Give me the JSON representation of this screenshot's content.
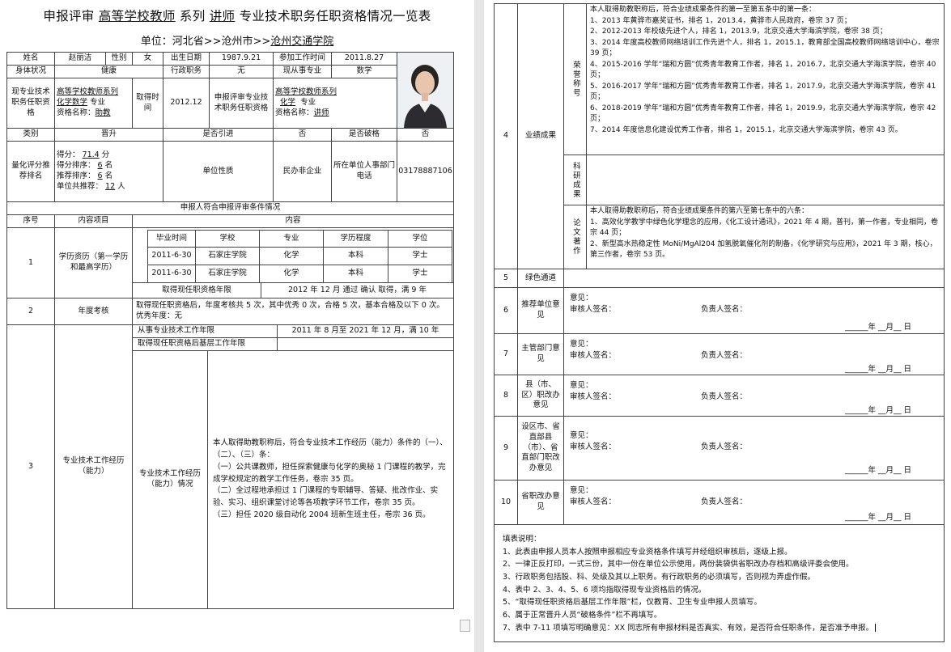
{
  "header": {
    "title_prefix": "申报评审",
    "series": "高等学校教师",
    "series_suffix": "系列",
    "level": "讲师",
    "title_suffix": "专业技术职务任职资格情况一览表",
    "unit_label": "单位：河北省>>沧州市>>",
    "unit_name": "沧州交通学院"
  },
  "basic": {
    "name_label": "姓名",
    "name": "赵丽洁",
    "gender_label": "性别",
    "gender": "女",
    "dob_label": "出生日期",
    "dob": "1987.9.21",
    "work_start_label": "参加工作时间",
    "work_start": "2011.8.27",
    "health_label": "身体状况",
    "health": "健康",
    "admin_label": "行政职务",
    "admin": "无",
    "major_label": "现从事专业",
    "major": "数学",
    "cur_title_label": "现专业技术职务任职资格",
    "cur_series": "高等学校教师系列",
    "cur_major": "化学数学",
    "cur_major_suffix": "专业",
    "cur_qual_label": "资格名称：",
    "cur_qual": "助教",
    "obtain_label": "取得时间",
    "obtain": "2012.12",
    "apply_label": "申报评审专业技术职务任职资格",
    "apply_series": "高等学校教师系列",
    "apply_major": "化学",
    "apply_major_suffix": "专业",
    "apply_qual_label": "资格名称：",
    "apply_qual": "讲师",
    "type_label": "类别",
    "type": "晋升",
    "intro_label": "是否引进",
    "intro": "否",
    "exception_label": "是否破格",
    "exception": "否",
    "score_label": "量化评分推荐排名",
    "score_l1": "得分：",
    "score": "71.4",
    "score_u": "分",
    "rank_l": "得分排序：",
    "rank": "6",
    "rank_u": "名",
    "rec_l": "推荐排序：",
    "rec": "6",
    "rec_u": "名",
    "total_l": "单位共推荐：",
    "total": "12",
    "total_u": "人",
    "nature_label": "单位性质",
    "nature": "民办非企业",
    "hr_label": "所在单位人事部门电话",
    "hr_phone": "03178887106"
  },
  "conditions": {
    "heading": "申报人符合申报评审条件情况",
    "col_no": "序号",
    "col_item": "内容项目",
    "col_content": "内容",
    "r1_no": "1",
    "r1_item": "学历资历（第一学历和最高学历）",
    "edu_headers": [
      "毕业时间",
      "学校",
      "专业",
      "学历程度",
      "学位"
    ],
    "edu_rows": [
      [
        "2011-6-30",
        "石家庄学院",
        "化学",
        "本科",
        "学士"
      ],
      [
        "2011-6-30",
        "石家庄学院",
        "化学",
        "本科",
        "学士"
      ]
    ],
    "qual_years_label": "取得现任职资格年限",
    "qual_years": "2012 年 12 月  通过  确认 取得，满 9 年",
    "r2_no": "2",
    "r2_item": "年度考核",
    "r2_text": "取得现任职资格后，年度考核共 5 次，其中优秀 0 次，合格 5 次，基本合格及以下 0 次。优秀年度：无",
    "r3_no": "3",
    "r3_item": "专业技术工作经历（能力）",
    "r3_years_label": "从事专业技术工作年限",
    "r3_years": "2011 年 8 月至 2021 年 12 月，满 10 年",
    "r3_grass_label": "取得现任职资格后基层工作年限",
    "r3_sub": "专业技术工作经历（能力）情况",
    "r3_text": "本人取得助教职称后，符合专业技术工作经历（能力）条件的（一）、（二）、（三）条：\n（一）公共课教师，担任探索健康与化学的奥秘 1 门课程的教学，完成学校规定的教学工作任务，卷宗 35 页。\n（二）全过程地承担过 1 门课程的专职辅导、答疑、批改作业、实验、实习、组织课堂讨论等各项教学环节工作，卷宗 35 页。\n（三）担任 2020 级自动化 2004 班新生班主任，卷宗 36 页。"
  },
  "achievements": {
    "r4_no": "4",
    "r4_item": "业绩成果",
    "honor_label": "荣誉称号",
    "honor_text": "本人取得助教职称后，符合业绩成果条件的第一至第五条中的第一条：\n1、2013 年黄骅市嘉奖证书，排名 1，2013.4，黄骅市人民政府，卷宗 37 页；\n2、2012-2013 年校级先进个人，排名 1，2013.9，北京交通大学海滨学院，卷宗 38 页；\n3、2014 年度高校教师网络培训工作先进个人，排名 1，2015.1，教育部全国高校教师网络培训中心，卷宗 39 页；\n4、2015-2016 学年“瑞和方圆”优秀青年教育工作者，排名 1，2016.7，北京交通大学海滨学院，卷宗 40 页；\n5、2016-2017 学年“瑞和方圆”优秀青年教育工作者，排名 1，2017.9，北京交通大学海滨学院，卷宗 41 页；\n6、2018-2019 学年“瑞和方圆”优秀青年教育工作者，排名 1，2019.9，北京交通大学海滨学院，卷宗 42 页；\n7、2014 年度信息化建设优秀工作者，排名 1，2015.1，北京交通大学海滨学院，卷宗 43 页。",
    "research_label": "科研成果",
    "paper_label": "论文著作",
    "paper_text": "本人取得助教职称后，符合业绩成果条件的第六至第七条中的六条：\n1、高效化学教学中绿色化学理念的应用，《化工设计通讯》，2021 年 4 期，普刊，第一作者，专业相同，卷宗 44 页；\n2、新型高水热稳定性 MoNi/MgAl204 加氢脱氧催化剂的制备，《化学研究与应用》，2021 年 3 期，核心，第三作者，卷宗 53 页。"
  },
  "opinions": {
    "r5_no": "5",
    "r5_item": "绿色通道",
    "opinion_label": "意见：",
    "reviewer_label": "审核人签名：",
    "leader_label": "负责人签名：",
    "date_label": "______年  __月__  日",
    "rows": [
      {
        "no": "6",
        "item": "推荐单位意见"
      },
      {
        "no": "7",
        "item": "主管部门意见"
      },
      {
        "no": "8",
        "item": "县（市、区）职改办意见"
      },
      {
        "no": "9",
        "item": "设区市、省直部县（市）、省直部门职改办意见"
      },
      {
        "no": "10",
        "item": "省职改办意见"
      }
    ]
  },
  "notes": {
    "title": "填表说明：",
    "items": [
      "1、此表由申报人员本人按照申报相应专业资格条件填写并经组织审核后，逐级上报。",
      "2、一律正反打印，一式三份，其中一份在单位公示使用，两份装袋供省职改办存档和高级评委会使用。",
      "3、行政职务包括股、科、处级及其以上职务。有行政职务的必须填写，否则视为弄虚作假。",
      "4、表中 2、3、4、5、6 项均指取得现专业资格后的情况。",
      "5、“取得现任职资格后基层工作年限”栏，仅教育、卫生专业申报人员填写。",
      "6、属于正常晋升人员“破格条件”栏不再填写。",
      "7、表中 7-11 项填写明确意见：XX 同志所有申报材料是否真实、有效，是否符合任职条件，是否准予申报。"
    ]
  }
}
